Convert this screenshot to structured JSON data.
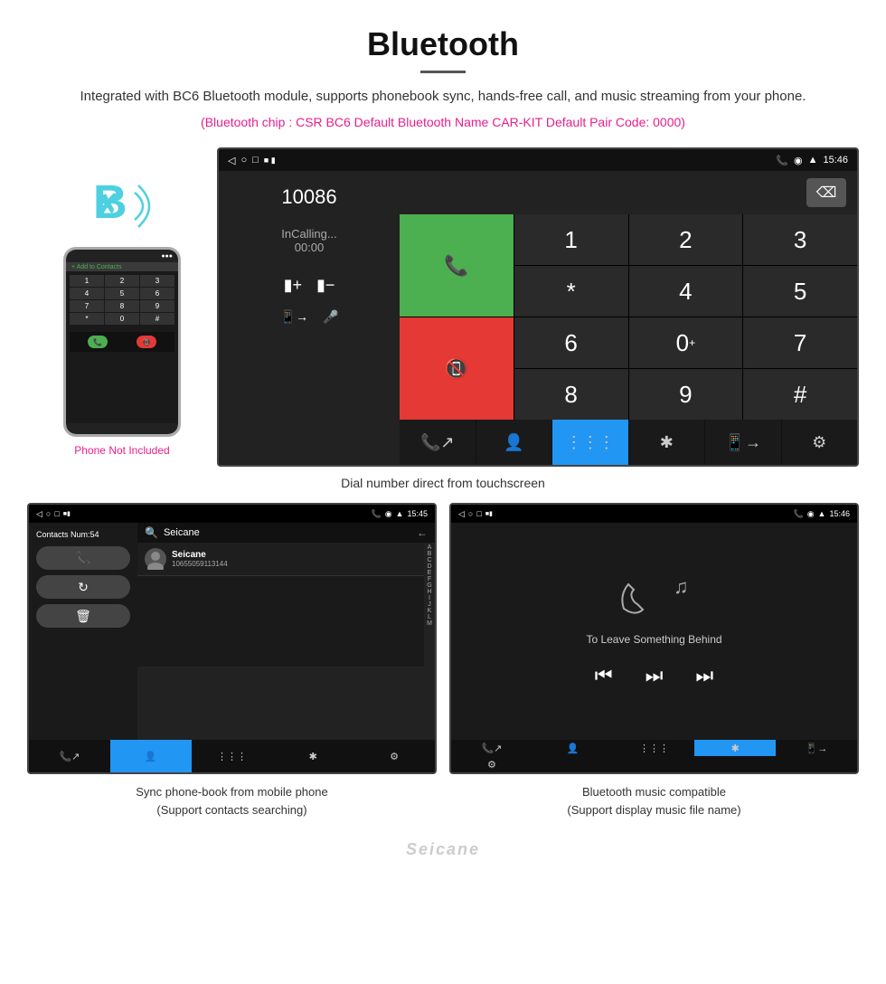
{
  "page": {
    "title": "Bluetooth",
    "divider": true,
    "description": "Integrated with BC6 Bluetooth module, supports phonebook sync, hands-free call, and music streaming from your phone.",
    "specs": "(Bluetooth chip : CSR BC6    Default Bluetooth Name CAR-KIT    Default Pair Code: 0000)",
    "phone_not_included": "Phone Not Included",
    "dial_caption": "Dial number direct from touchscreen",
    "contacts_caption_line1": "Sync phone-book from mobile phone",
    "contacts_caption_line2": "(Support contacts searching)",
    "music_caption_line1": "Bluetooth music compatible",
    "music_caption_line2": "(Support display music file name)"
  },
  "dial_screen": {
    "status_time": "15:46",
    "number": "10086",
    "calling_label": "InCalling...",
    "call_time": "00:00",
    "numpad": [
      "1",
      "2",
      "3",
      "*",
      "4",
      "5",
      "6",
      "0+",
      "7",
      "8",
      "9",
      "#"
    ],
    "bottom_tabs": [
      "calls",
      "contacts",
      "numpad",
      "bluetooth",
      "transfer",
      "settings"
    ]
  },
  "contacts_screen": {
    "status_time": "15:45",
    "contacts_num": "Contacts Num:54",
    "search_placeholder": "Seicane",
    "contact_name": "Seicane",
    "contact_phone": "10655059113144",
    "alpha_letters": [
      "A",
      "B",
      "C",
      "D",
      "E",
      "F",
      "G",
      "H",
      "I",
      "J",
      "K",
      "L",
      "M"
    ]
  },
  "music_screen": {
    "status_time": "15:46",
    "song_title": "To Leave Something Behind",
    "controls": [
      "prev",
      "play-pause",
      "next"
    ]
  }
}
